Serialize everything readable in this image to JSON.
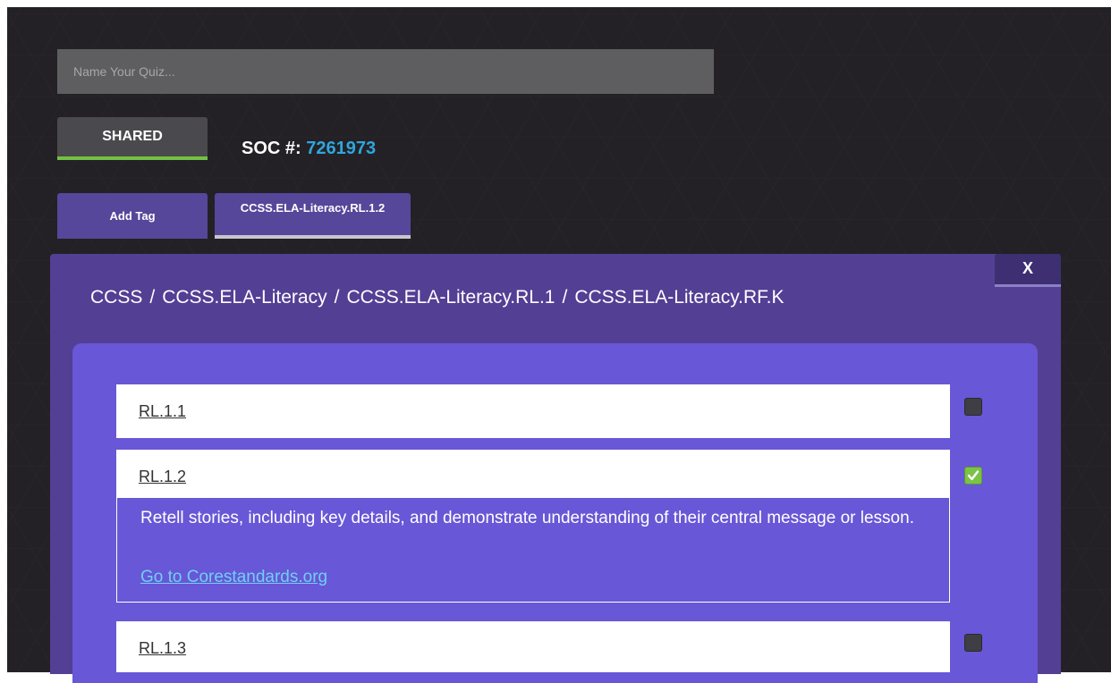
{
  "quiz_name": {
    "placeholder": "Name Your Quiz...",
    "value": ""
  },
  "shared_button": {
    "label": "SHARED"
  },
  "soc": {
    "label": "SOC #:",
    "value": "7261973"
  },
  "tags": {
    "add_label": "Add Tag",
    "items": [
      {
        "label": "CCSS.ELA-Literacy.RL.1.2"
      }
    ]
  },
  "panel": {
    "close_label": "X",
    "breadcrumb": [
      {
        "label": "CCSS"
      },
      {
        "label": "CCSS.ELA-Literacy"
      },
      {
        "label": "CCSS.ELA-Literacy.RL.1"
      },
      {
        "label": "CCSS.ELA-Literacy.RF.K"
      }
    ],
    "breadcrumb_separator": "/",
    "standards": [
      {
        "code": "RL.1.1",
        "checked": false
      },
      {
        "code": "RL.1.2",
        "checked": true,
        "description": "Retell stories, including key details, and demonstrate understanding of their central message or lesson.",
        "link_label": "Go to Corestandards.org"
      },
      {
        "code": "RL.1.3",
        "checked": false
      }
    ]
  },
  "colors": {
    "background": "#232126",
    "accent_green": "#74c043",
    "soc_blue": "#2fa6dc",
    "panel_purple": "#533f94",
    "inner_purple": "#6857d6",
    "tag_purple": "#56479a",
    "link_blue": "#6fd0f5"
  },
  "icons": {
    "checkmark": "check-icon"
  }
}
